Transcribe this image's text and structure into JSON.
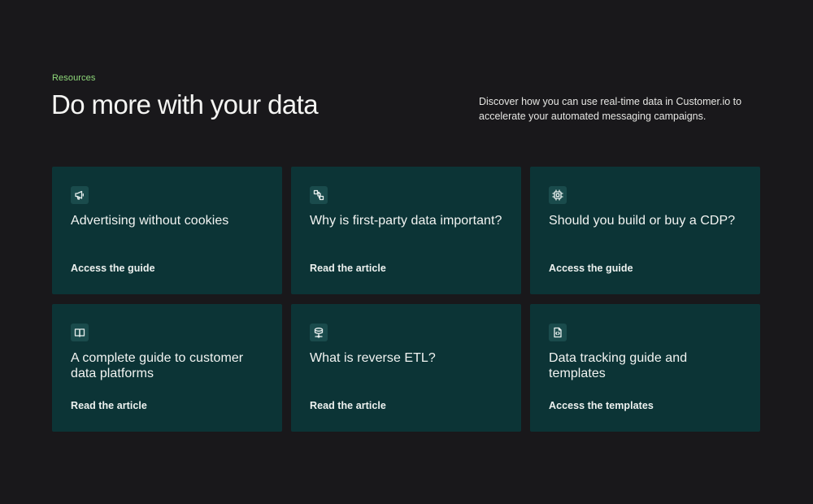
{
  "header": {
    "eyebrow": "Resources",
    "title": "Do more with your data",
    "description": "Discover how you can use real-time data in Customer.io to accelerate your automated messaging campaigns."
  },
  "colors": {
    "background": "#19181b",
    "card": "#0c3436",
    "accent": "#8fd97a"
  },
  "cards": [
    {
      "icon": "megaphone-icon",
      "title": "Advertising without cookies",
      "link": "Access the guide"
    },
    {
      "icon": "nodes-icon",
      "title": "Why is first-party data important?",
      "link": "Read the article"
    },
    {
      "icon": "chip-icon",
      "title": "Should you build or buy a CDP?",
      "link": "Access the guide"
    },
    {
      "icon": "book-icon",
      "title": "A complete guide to customer data platforms",
      "link": "Read the article"
    },
    {
      "icon": "database-icon",
      "title": "What is reverse ETL?",
      "link": "Read the article"
    },
    {
      "icon": "code-file-icon",
      "title": "Data tracking guide and templates",
      "link": "Access the templates"
    }
  ]
}
